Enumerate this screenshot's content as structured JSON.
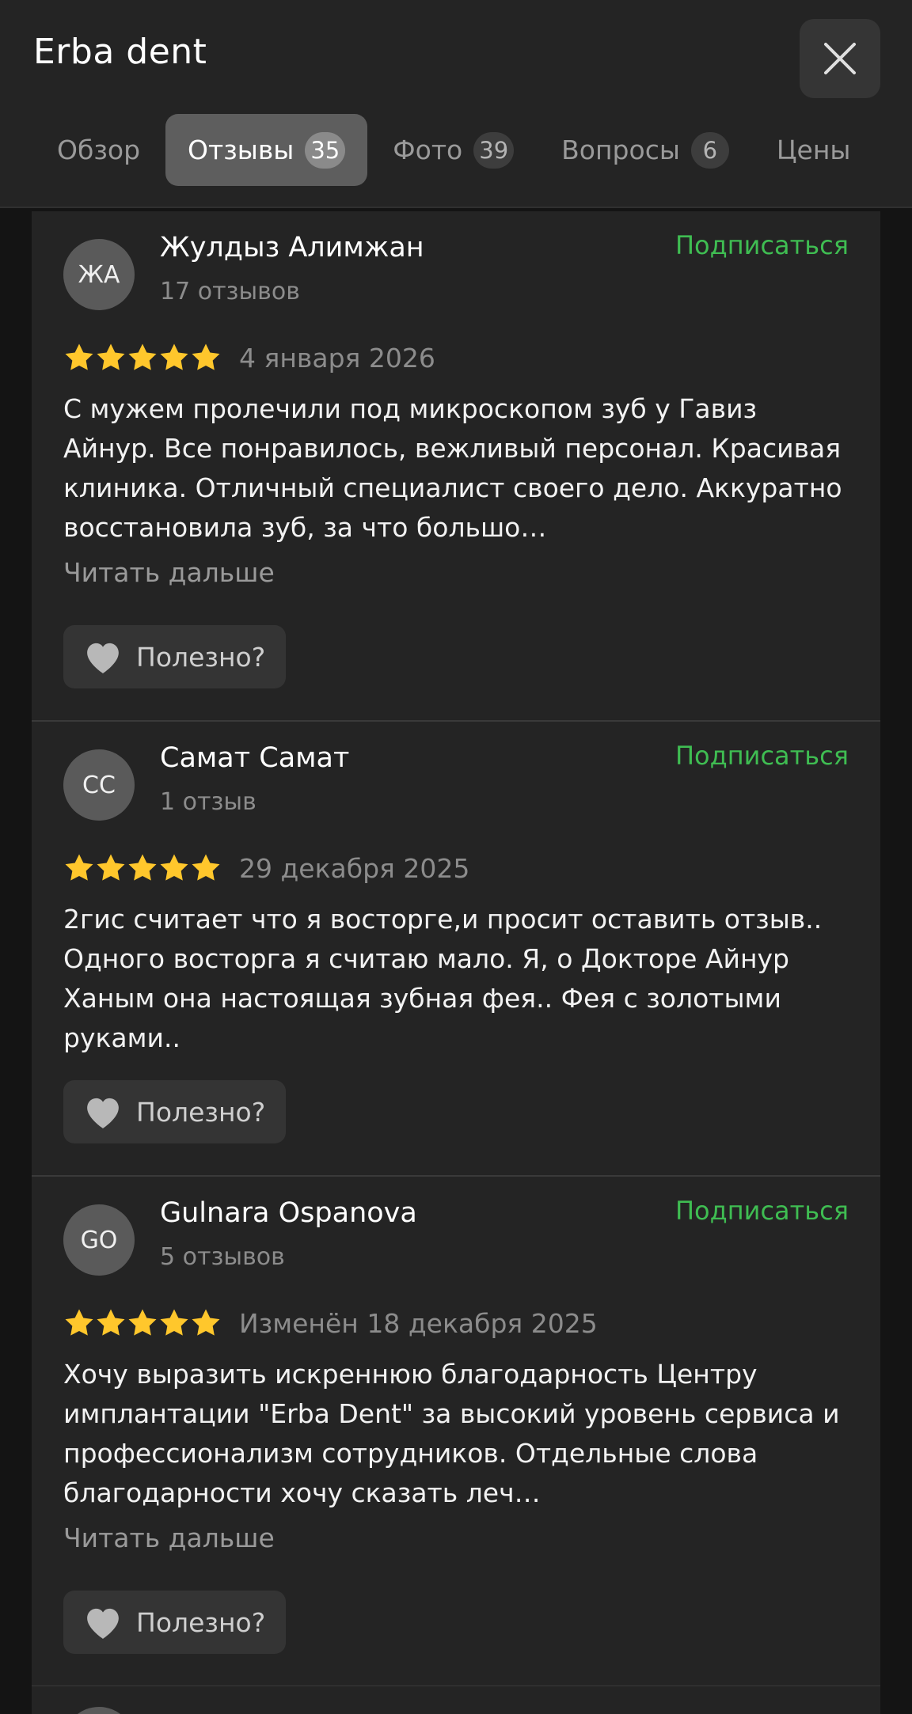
{
  "header": {
    "title": "Erba dent",
    "close_icon": "close-icon"
  },
  "tabs": [
    {
      "label": "Обзор",
      "count": null,
      "active": false
    },
    {
      "label": "Отзывы",
      "count": "35",
      "active": true
    },
    {
      "label": "Фото",
      "count": "39",
      "active": false
    },
    {
      "label": "Вопросы",
      "count": "6",
      "active": false
    },
    {
      "label": "Цены",
      "count": null,
      "active": false
    }
  ],
  "colors": {
    "accent_green": "#3fbd52",
    "star_yellow": "#ffc72c",
    "background": "#242424"
  },
  "reviews": [
    {
      "initials": "ЖА",
      "name": "Жулдыз Алимжан",
      "count": "17 отзывов",
      "subscribe": "Подписаться",
      "rating": 5,
      "date": "4 января 2026",
      "text": "С мужем пролечили под микроскопом зуб у Гавиз Айнур. Все понравилось, вежливый персонал. Красивая клиника. Отличный специалист своего дело. Аккуратно восстановила зуб, за что большо…",
      "read_more": "Читать дальше",
      "helpful": "Полезно?"
    },
    {
      "initials": "СС",
      "name": "Самат Самат",
      "count": "1 отзыв",
      "subscribe": "Подписаться",
      "rating": 5,
      "date": "29 декабря 2025",
      "text": "2гис считает что я восторге,и просит оставить отзыв.. Одного восторга я считаю мало. Я, о Докторе Айнур Ханым она настоящая зубная фея.. Фея с золотыми руками..",
      "read_more": null,
      "helpful": "Полезно?"
    },
    {
      "initials": "GO",
      "name": "Gulnara Ospanova",
      "count": "5 отзывов",
      "subscribe": "Подписаться",
      "rating": 5,
      "date": "Изменён 18 декабря 2025",
      "text": "Хочу выразить искреннюю благодарность Центру имплантации \"Erba Dent\" за высокий уровень сервиса и профессионализм сотрудников. Отдельные слова благодарности хочу сказать леч…",
      "read_more": "Читать дальше",
      "helpful": "Полезно?"
    }
  ]
}
